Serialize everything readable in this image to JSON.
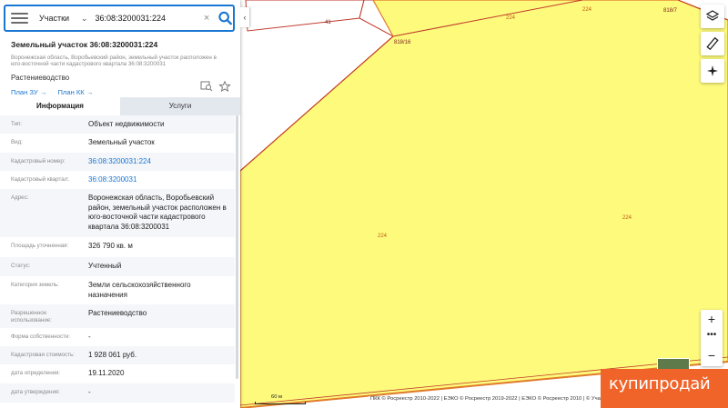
{
  "search": {
    "type_label": "Участки",
    "query": "36:08:3200031:224"
  },
  "parcel": {
    "title": "Земельный участок 36:08:3200031:224",
    "address": "Воронежская область, Воробьевский район, земельный участок расположен в юго-восточной части кадастрового квартала 36:08:3200031",
    "purpose": "Растениеводство",
    "link_plan_zu": "План ЗУ →",
    "link_plan_kk": "План КК →"
  },
  "tabs": [
    {
      "label": "Информация"
    },
    {
      "label": "Услуги"
    }
  ],
  "info_rows": [
    {
      "label": "Тип:",
      "value": "Объект недвижимости"
    },
    {
      "label": "Вид:",
      "value": "Земельный участок"
    },
    {
      "label": "Кадастровый номер:",
      "value": "36:08:3200031:224"
    },
    {
      "label": "Кадастровый квартал:",
      "value": "36:08:3200031"
    },
    {
      "label": "Адрес:",
      "value": "Воронежская область, Воробьевский район, земельный участок расположен в юго-восточной части кадастрового квартала 36:08:3200031"
    },
    {
      "label": "Площадь уточненная:",
      "value": "326 790 кв. м"
    },
    {
      "label": "Статус:",
      "value": "Учтенный"
    },
    {
      "label": "Категория земель:",
      "value": "Земли сельскохозяйственного назначения"
    },
    {
      "label": "Разрешенное использование:",
      "value": "Растениеводство"
    },
    {
      "label": "Форма собственности:",
      "value": "-"
    },
    {
      "label": "Кадастровая стоимость:",
      "value": "1 928 061 руб."
    },
    {
      "label": "дата определения:",
      "value": "19.11.2020"
    },
    {
      "label": "дата утверждения:",
      "value": "-"
    }
  ],
  "map_labels": {
    "l41": "41",
    "l818_16": "818/16",
    "l224_top": "224",
    "l224_topright": "224",
    "l818_7": "818/7",
    "l224_right": "224",
    "l224_center": "224"
  },
  "scale": "60 м",
  "copyright": "ПКК © Росреестр 2010-2022 | ЕЭКО © Росреестр 2019-2022 | ЕЭКО © Росреестр 2010 | © Участники OpenStreetMap",
  "watermark": "купипродай",
  "colors": {
    "parcel_fill": "#fdfa7c",
    "parcel_border": "#e07a2a",
    "accent": "#1976d2",
    "watermark_bg": "#f0642a"
  }
}
